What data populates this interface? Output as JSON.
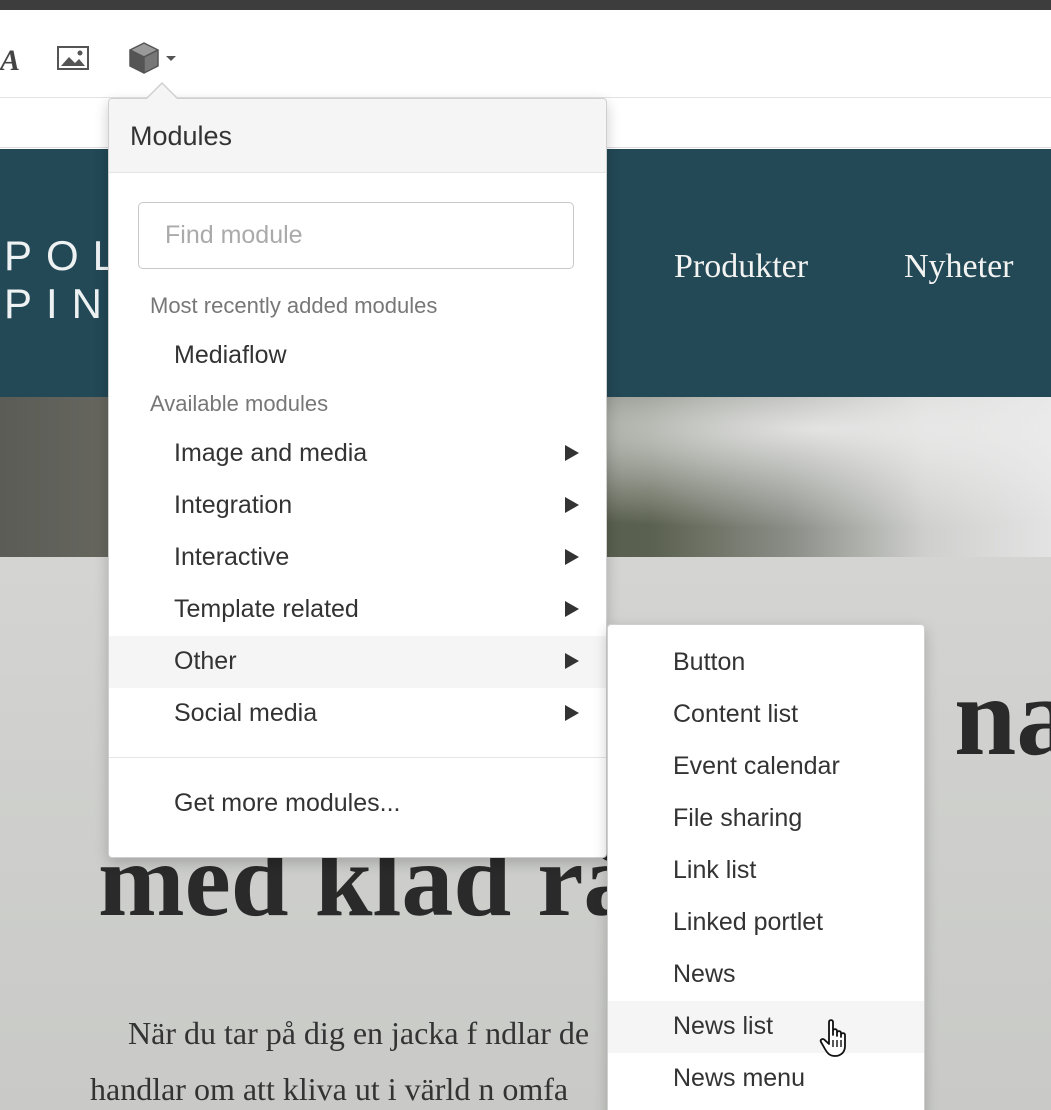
{
  "toolbar": {
    "text_icon": "A",
    "icons": [
      "text-style-icon",
      "image-icon",
      "module-cube-icon",
      "caret-down-icon"
    ]
  },
  "site": {
    "logo_line1": "POL",
    "logo_line2": "PIN",
    "nav": [
      "Produkter",
      "Nyheter"
    ],
    "headline_1": "na",
    "headline_2": "med klad    rån",
    "body_line1": "När du tar på dig en jacka f                       ndlar de",
    "body_line2": "handlar om att kliva ut i värld                     n omfa"
  },
  "modules_menu": {
    "title": "Modules",
    "search_placeholder": "Find module",
    "recent_label": "Most recently added modules",
    "recent_items": [
      "Mediaflow"
    ],
    "available_label": "Available modules",
    "categories": [
      "Image and media",
      "Integration",
      "Interactive",
      "Template related",
      "Other",
      "Social media"
    ],
    "highlighted_category": "Other",
    "more_link": "Get more modules..."
  },
  "other_submenu": {
    "items": [
      "Button",
      "Content list",
      "Event calendar",
      "File sharing",
      "Link list",
      "Linked portlet",
      "News",
      "News list",
      "News menu"
    ],
    "highlighted_item": "News list"
  },
  "colors": {
    "header_bg": "#234856",
    "menu_highlight": "#f5f5f5",
    "toolbar_dark": "#3d3d3d"
  }
}
